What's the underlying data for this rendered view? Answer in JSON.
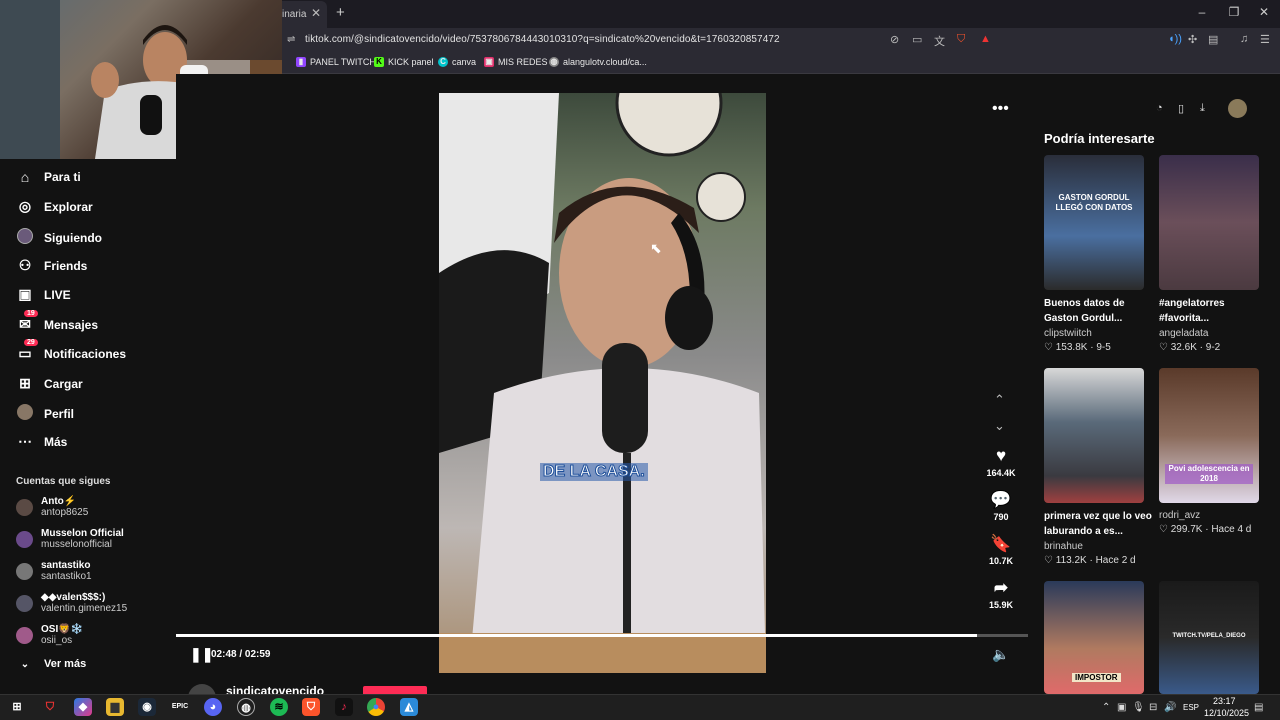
{
  "browser": {
    "tab_title": "inaria",
    "url": "tiktok.com/@sindicatovencido/video/7537806784443010310?q=sindicato%20vencido&t=1760320857472",
    "bookmarks": [
      {
        "label": "PANEL TWITCH",
        "icon": "twitch-icon",
        "color": "#9146ff"
      },
      {
        "label": "KICK panel",
        "icon": "kick-icon",
        "color": "#53fc18"
      },
      {
        "label": "canva",
        "icon": "canva-icon",
        "color": "#00c4cc"
      },
      {
        "label": "MIS REDES",
        "icon": "redes-icon",
        "color": "#e1306c"
      },
      {
        "label": "alangulotv.cloud/ca...",
        "icon": "globe-icon",
        "color": "#888888"
      }
    ]
  },
  "sidebar": {
    "items": [
      {
        "label": "Para ti",
        "icon": "home-icon"
      },
      {
        "label": "Explorar",
        "icon": "compass-icon"
      },
      {
        "label": "Siguiendo",
        "icon": "following-icon"
      },
      {
        "label": "Friends",
        "icon": "friends-icon"
      },
      {
        "label": "LIVE",
        "icon": "live-icon"
      },
      {
        "label": "Mensajes",
        "icon": "messages-icon",
        "badge": "19"
      },
      {
        "label": "Notificaciones",
        "icon": "notifications-icon",
        "badge": "29"
      },
      {
        "label": "Cargar",
        "icon": "upload-icon"
      },
      {
        "label": "Perfil",
        "icon": "profile-icon"
      },
      {
        "label": "Más",
        "icon": "more-icon"
      }
    ],
    "following_title": "Cuentas que sigues",
    "accounts": [
      {
        "name": "Anto⚡",
        "handle": "antop8625"
      },
      {
        "name": "Musselon Official",
        "handle": "musselonofficial"
      },
      {
        "name": "santastiko",
        "handle": "santastiko1"
      },
      {
        "name": "◆◆valen$$$:)",
        "handle": "valentin.gimenez15"
      },
      {
        "name": "OSI🦁❄️",
        "handle": "osii_os"
      }
    ],
    "see_more": "Ver más"
  },
  "video": {
    "caption": "DE LA CASA.",
    "author": "sindicatovencido",
    "likes": "164.4K",
    "comments": "790",
    "saves": "10.7K",
    "shares": "15.9K",
    "time": "02:48 / 02:59",
    "progress": 0.94
  },
  "recommendations": {
    "title": "Podría interesarte",
    "items": [
      {
        "title": "Buenos datos de Gaston Gordul...",
        "author": "clipstwiitch",
        "stats": "♡ 153.8K · 9-5",
        "thumb_text": "GASTON GORDUL LLEGÓ CON DATOS"
      },
      {
        "title": "#angelatorres #favorita...",
        "author": "angeladata",
        "stats": "♡ 32.6K · 9-2",
        "thumb_text": ""
      },
      {
        "title": "primera vez que lo veo laburando a es...",
        "author": "brinahue",
        "stats": "♡ 113.2K · Hace 2 d",
        "thumb_text": ""
      },
      {
        "title": "",
        "author": "rodri_avz",
        "stats": "♡ 299.7K · Hace 4 d",
        "thumb_text": "Povi adolescencia en 2018"
      },
      {
        "title": "",
        "author": "",
        "stats": "",
        "thumb_text": "IMPOSTOR"
      },
      {
        "title": "",
        "author": "",
        "stats": "",
        "thumb_text": "TWITCH.TV/PELA_DIEGO"
      }
    ]
  },
  "taskbar": {
    "time": "23:17",
    "date": "12/10/2025",
    "lang": "ESP"
  }
}
